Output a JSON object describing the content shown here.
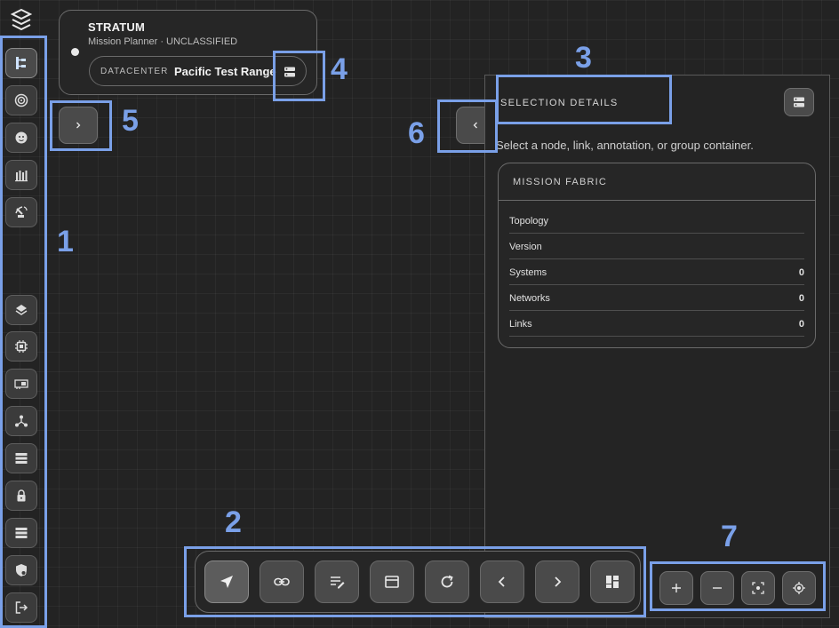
{
  "header": {
    "title": "STRATUM",
    "subtitle": "Mission Planner · UNCLASSIFIED",
    "datacenter_label": "DATACENTER",
    "datacenter_value": "Pacific Test Range"
  },
  "rail": {
    "items": [
      {
        "icon": "topology-icon",
        "active": true
      },
      {
        "icon": "target-icon"
      },
      {
        "icon": "bug-icon"
      },
      {
        "icon": "inventory-icon"
      },
      {
        "icon": "satellite-dish-icon"
      },
      {
        "icon": "layers-icon"
      },
      {
        "icon": "cpu-icon"
      },
      {
        "icon": "network-card-icon"
      },
      {
        "icon": "hub-icon"
      },
      {
        "icon": "server-list-icon"
      },
      {
        "icon": "lock-icon"
      },
      {
        "icon": "server-rack-icon"
      },
      {
        "icon": "shield-icon"
      },
      {
        "icon": "logout-icon"
      }
    ]
  },
  "panel": {
    "title": "SELECTION DETAILS",
    "hint": "Select a node, link, annotation, or group container.",
    "fabric": {
      "title": "MISSION FABRIC",
      "rows": [
        {
          "label": "Topology",
          "value": ""
        },
        {
          "label": "Version",
          "value": ""
        },
        {
          "label": "Systems",
          "value": "0"
        },
        {
          "label": "Networks",
          "value": "0"
        },
        {
          "label": "Links",
          "value": "0"
        }
      ]
    }
  },
  "toolbar": {
    "buttons": [
      "select-tool-icon",
      "link-tool-icon",
      "annotate-tool-icon",
      "group-container-icon",
      "refresh-icon",
      "undo-icon",
      "redo-icon",
      "layout-dashboard-icon"
    ]
  },
  "zoom": {
    "buttons": [
      "zoom-in-icon",
      "zoom-out-icon",
      "fit-view-icon",
      "center-icon"
    ]
  },
  "annotations": {
    "labels": [
      "1",
      "2",
      "3",
      "4",
      "5",
      "6",
      "7"
    ],
    "color": "#7aa0e8"
  }
}
